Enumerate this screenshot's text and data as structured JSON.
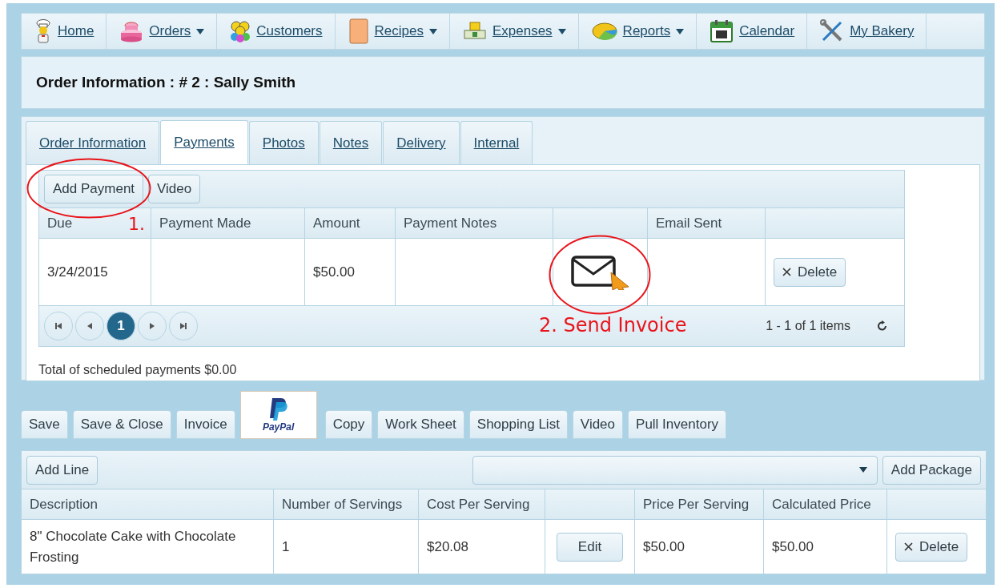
{
  "nav": [
    {
      "label": "Home",
      "has_menu": false
    },
    {
      "label": "Orders",
      "has_menu": true
    },
    {
      "label": "Customers",
      "has_menu": false
    },
    {
      "label": "Recipes",
      "has_menu": true
    },
    {
      "label": "Expenses",
      "has_menu": true
    },
    {
      "label": "Reports",
      "has_menu": true
    },
    {
      "label": "Calendar",
      "has_menu": false
    },
    {
      "label": "My Bakery",
      "has_menu": false
    }
  ],
  "title": "Order Information : # 2 : Sally Smith",
  "tabs": [
    {
      "label": "Order Information",
      "selected": false
    },
    {
      "label": "Payments",
      "selected": true
    },
    {
      "label": "Photos",
      "selected": false
    },
    {
      "label": "Notes",
      "selected": false
    },
    {
      "label": "Delivery",
      "selected": false
    },
    {
      "label": "Internal",
      "selected": false
    }
  ],
  "payments": {
    "buttons": [
      "Add Payment",
      "Video"
    ],
    "columns": [
      "Due",
      "Payment Made",
      "Amount",
      "Payment Notes",
      "",
      "Email Sent",
      ""
    ],
    "rows": [
      {
        "cells": [
          {
            "kind": "text",
            "text": "3/24/2015"
          },
          {
            "kind": "empty"
          },
          {
            "kind": "text",
            "text": "$50.00"
          },
          {
            "kind": "empty"
          },
          {
            "kind": "email"
          },
          {
            "kind": "empty"
          },
          {
            "kind": "delete",
            "label": "Delete"
          }
        ]
      }
    ],
    "pages": [
      {
        "label": "1",
        "selected": true
      }
    ],
    "summary": "1 - 1 of 1 items",
    "total": "Total of scheduled payments $0.00"
  },
  "annotations": [
    {
      "kind": "circle"
    },
    {
      "kind": "label",
      "text": "1."
    },
    {
      "kind": "circle"
    },
    {
      "kind": "label",
      "text": "2. Send Invoice"
    }
  ],
  "actions": [
    {
      "kind": "button",
      "label": "Save"
    },
    {
      "kind": "button",
      "label": "Save & Close"
    },
    {
      "kind": "button",
      "label": "Invoice"
    },
    {
      "kind": "logo",
      "label": "PayPal"
    },
    {
      "kind": "button",
      "label": "Copy"
    },
    {
      "kind": "button",
      "label": "Work Sheet"
    },
    {
      "kind": "button",
      "label": "Shopping List"
    },
    {
      "kind": "button",
      "label": "Video"
    },
    {
      "kind": "button",
      "label": "Pull Inventory"
    }
  ],
  "lines": {
    "add_line": "Add Line",
    "add_package": "Add Package",
    "columns": [
      "Description",
      "Number of Servings",
      "Cost Per Serving",
      "",
      "Price Per Serving",
      "Calculated Price",
      ""
    ],
    "rows": [
      {
        "cells": [
          {
            "kind": "text",
            "text": "8\" Chocolate Cake with Chocolate Frosting"
          },
          {
            "kind": "text",
            "text": "1"
          },
          {
            "kind": "text",
            "text": "$20.08"
          },
          {
            "kind": "edit",
            "label": "Edit"
          },
          {
            "kind": "text",
            "text": "$50.00"
          },
          {
            "kind": "text",
            "text": "$50.00"
          },
          {
            "kind": "delete",
            "label": "Delete"
          }
        ]
      }
    ]
  }
}
